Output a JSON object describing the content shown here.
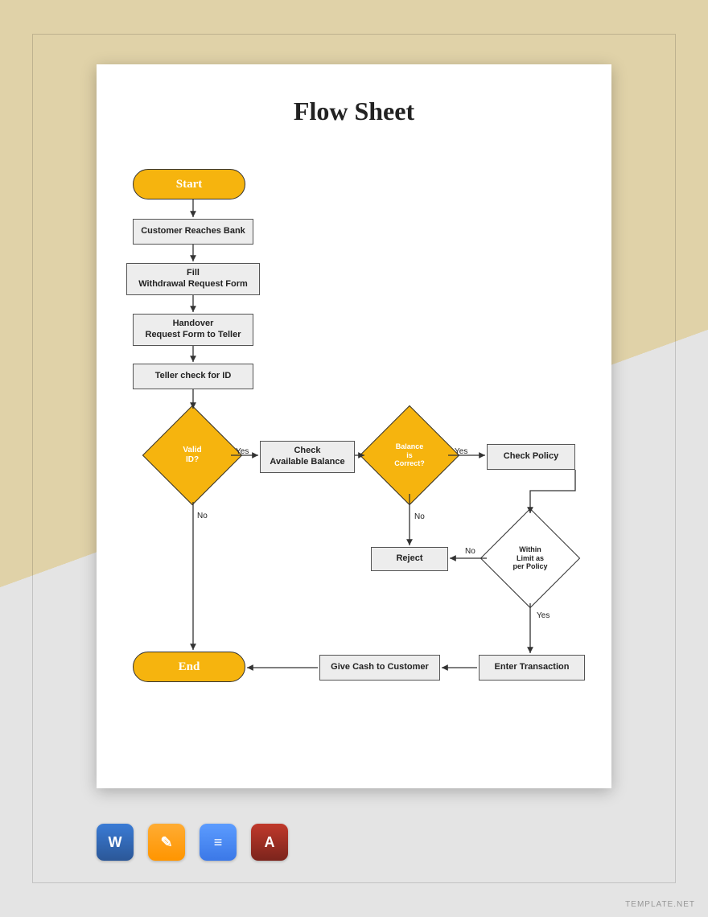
{
  "title": "Flow Sheet",
  "nodes": {
    "start": "Start",
    "n1": "Customer Reaches Bank",
    "n2": "Fill\nWithdrawal Request Form",
    "n3": "Handover\nRequest Form to Teller",
    "n4": "Teller check for ID",
    "d1": "Valid\nID?",
    "n5": "Check\nAvailable Balance",
    "d2": "Balance\nis\nCorrect?",
    "n6": "Check Policy",
    "d3": "Within\nLimit as\nper Policy",
    "n7": "Reject",
    "n8": "Enter Transaction",
    "n9": "Give Cash to Customer",
    "end": "End"
  },
  "labels": {
    "yes": "Yes",
    "no": "No"
  },
  "formats": {
    "word": "W",
    "pages": "✎",
    "gdoc": "≡",
    "pdf": "A"
  },
  "watermark": "TEMPLATE.NET"
}
